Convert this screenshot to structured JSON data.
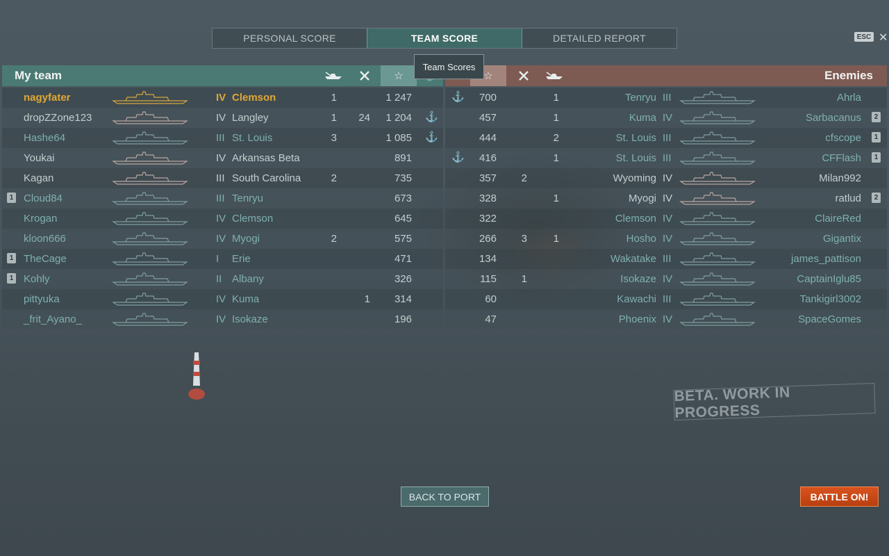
{
  "tabs": [
    {
      "label": "PERSONAL SCORE",
      "active": false
    },
    {
      "label": "TEAM SCORE",
      "active": true
    },
    {
      "label": "DETAILED REPORT",
      "active": false
    }
  ],
  "esc_label": "ESC",
  "close_glyph": "✕",
  "tooltip": "Team Scores",
  "my_team": {
    "title": "My team",
    "columns_icons": [
      "ship-kills-icon",
      "planes-icon",
      "star-score-icon",
      "base-capture-icon"
    ],
    "rows": [
      {
        "player": "nagyfater",
        "tier": "IV",
        "ship": "Clemson",
        "kills": "1",
        "planes": "",
        "score": "1 247",
        "anchor": false,
        "badge": "",
        "style": "me"
      },
      {
        "player": "dropZZone123",
        "tier": "IV",
        "ship": "Langley",
        "kills": "1",
        "planes": "24",
        "score": "1 204",
        "anchor": true,
        "badge": "",
        "style": "alive"
      },
      {
        "player": "Hashe64",
        "tier": "III",
        "ship": "St. Louis",
        "kills": "3",
        "planes": "",
        "score": "1 085",
        "anchor": true,
        "badge": "",
        "style": "dead"
      },
      {
        "player": "Youkai",
        "tier": "IV",
        "ship": "Arkansas Beta",
        "kills": "",
        "planes": "",
        "score": "891",
        "anchor": false,
        "badge": "",
        "style": "alive"
      },
      {
        "player": "Kagan",
        "tier": "III",
        "ship": "South Carolina",
        "kills": "2",
        "planes": "",
        "score": "735",
        "anchor": false,
        "badge": "",
        "style": "alive"
      },
      {
        "player": "Cloud84",
        "tier": "III",
        "ship": "Tenryu",
        "kills": "",
        "planes": "",
        "score": "673",
        "anchor": false,
        "badge": "1",
        "style": "dead"
      },
      {
        "player": "Krogan",
        "tier": "IV",
        "ship": "Clemson",
        "kills": "",
        "planes": "",
        "score": "645",
        "anchor": false,
        "badge": "",
        "style": "dead"
      },
      {
        "player": "kloon666",
        "tier": "IV",
        "ship": "Myogi",
        "kills": "2",
        "planes": "",
        "score": "575",
        "anchor": false,
        "badge": "",
        "style": "dead"
      },
      {
        "player": "TheCage",
        "tier": "I",
        "ship": "Erie",
        "kills": "",
        "planes": "",
        "score": "471",
        "anchor": false,
        "badge": "1",
        "style": "dead"
      },
      {
        "player": "Kohly",
        "tier": "II",
        "ship": "Albany",
        "kills": "",
        "planes": "",
        "score": "326",
        "anchor": false,
        "badge": "1",
        "style": "dead"
      },
      {
        "player": "pittyuka",
        "tier": "IV",
        "ship": "Kuma",
        "kills": "",
        "planes": "1",
        "score": "314",
        "anchor": false,
        "badge": "",
        "style": "dead"
      },
      {
        "player": "_frit_Ayano_",
        "tier": "IV",
        "ship": "Isokaze",
        "kills": "",
        "planes": "",
        "score": "196",
        "anchor": false,
        "badge": "",
        "style": "dead"
      }
    ]
  },
  "enemies": {
    "title": "Enemies",
    "columns_icons": [
      "base-capture-icon",
      "star-score-icon",
      "planes-icon",
      "ship-kills-icon"
    ],
    "rows": [
      {
        "player": "Ahrla",
        "tier": "III",
        "ship": "Tenryu",
        "kills": "1",
        "planes": "",
        "score": "700",
        "anchor": true,
        "badge": "",
        "style": "dead"
      },
      {
        "player": "Sarbacanus",
        "tier": "IV",
        "ship": "Kuma",
        "kills": "1",
        "planes": "",
        "score": "457",
        "anchor": false,
        "badge": "2",
        "style": "dead"
      },
      {
        "player": "cfscope",
        "tier": "III",
        "ship": "St. Louis",
        "kills": "2",
        "planes": "",
        "score": "444",
        "anchor": false,
        "badge": "1",
        "style": "dead"
      },
      {
        "player": "CFFlash",
        "tier": "III",
        "ship": "St. Louis",
        "kills": "1",
        "planes": "",
        "score": "416",
        "anchor": true,
        "badge": "1",
        "style": "dead"
      },
      {
        "player": "Milan992",
        "tier": "IV",
        "ship": "Wyoming",
        "kills": "",
        "planes": "2",
        "score": "357",
        "anchor": false,
        "badge": "",
        "style": "alive"
      },
      {
        "player": "ratlud",
        "tier": "IV",
        "ship": "Myogi",
        "kills": "1",
        "planes": "",
        "score": "328",
        "anchor": false,
        "badge": "2",
        "style": "alive"
      },
      {
        "player": "ClaireRed",
        "tier": "IV",
        "ship": "Clemson",
        "kills": "",
        "planes": "",
        "score": "322",
        "anchor": false,
        "badge": "",
        "style": "dead"
      },
      {
        "player": "Gigantix",
        "tier": "IV",
        "ship": "Hosho",
        "kills": "1",
        "planes": "3",
        "score": "266",
        "anchor": false,
        "badge": "",
        "style": "dead"
      },
      {
        "player": "james_pattison",
        "tier": "III",
        "ship": "Wakatake",
        "kills": "",
        "planes": "",
        "score": "134",
        "anchor": false,
        "badge": "",
        "style": "dead"
      },
      {
        "player": "CaptainIglu85",
        "tier": "IV",
        "ship": "Isokaze",
        "kills": "",
        "planes": "1",
        "score": "115",
        "anchor": false,
        "badge": "",
        "style": "dead"
      },
      {
        "player": "Tankigirl3002",
        "tier": "III",
        "ship": "Kawachi",
        "kills": "",
        "planes": "",
        "score": "60",
        "anchor": false,
        "badge": "",
        "style": "dead"
      },
      {
        "player": "SpaceGomes",
        "tier": "IV",
        "ship": "Phoenix",
        "kills": "",
        "planes": "",
        "score": "47",
        "anchor": false,
        "badge": "",
        "style": "dead"
      }
    ]
  },
  "watermark": "BETA. WORK IN PROGRESS",
  "buttons": {
    "back": "BACK TO PORT",
    "battle": "BATTLE ON!"
  },
  "colors": {
    "my_team_header": "#4b7a74",
    "enemies_header": "#7d5b52",
    "own_player": "#e0a734",
    "battle_button": "#d9531f"
  }
}
